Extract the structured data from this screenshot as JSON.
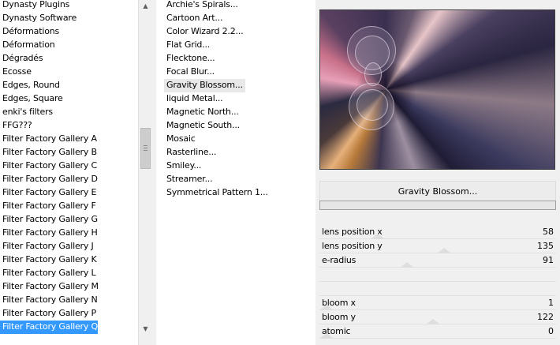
{
  "categories": {
    "items": [
      "Dynasty Plugins",
      "Dynasty Software",
      "Déformations",
      "Déformation",
      "Dégradés",
      "Ecosse",
      "Edges, Round",
      "Edges, Square",
      "enki's filters",
      "FFG???",
      "Filter Factory Gallery A",
      "Filter Factory Gallery B",
      "Filter Factory Gallery C",
      "Filter Factory Gallery D",
      "Filter Factory Gallery E",
      "Filter Factory Gallery F",
      "Filter Factory Gallery G",
      "Filter Factory Gallery H",
      "Filter Factory Gallery J",
      "Filter Factory Gallery K",
      "Filter Factory Gallery L",
      "Filter Factory Gallery M",
      "Filter Factory Gallery N",
      "Filter Factory Gallery P",
      "Filter Factory Gallery Q"
    ],
    "selected_index": 24
  },
  "filters": {
    "items": [
      "Archie's Spirals...",
      "Cartoon Art...",
      "Color Wizard 2.2...",
      "Flat Grid...",
      "Flecktone...",
      "Focal Blur...",
      "Gravity Blossom...",
      "liquid Metal...",
      "Magnetic North...",
      "Magnetic South...",
      "Mosaic",
      "Rasterline...",
      "Smiley...",
      "Streamer...",
      "Symmetrical Pattern 1..."
    ],
    "current_index": 6
  },
  "preview": {
    "filter_title": "Gravity Blossom...",
    "progress": 0.0
  },
  "params": [
    {
      "label": "lens position x",
      "value": "58",
      "level": 0.23
    },
    {
      "label": "lens position y",
      "value": "135",
      "level": 0.53
    },
    {
      "label": "e-radius",
      "value": "91",
      "level": 0.36
    },
    {
      "label": "bloom x",
      "value": "1",
      "level": 0.0
    },
    {
      "label": "bloom y",
      "value": "122",
      "level": 0.48
    },
    {
      "label": "atomic",
      "value": "0",
      "level": 0.0
    }
  ],
  "colors": {
    "selection": "#3399ff",
    "panel_bg": "#f0f0f0"
  },
  "icons": {
    "scroll_up": "▲",
    "scroll_down": "▼"
  }
}
